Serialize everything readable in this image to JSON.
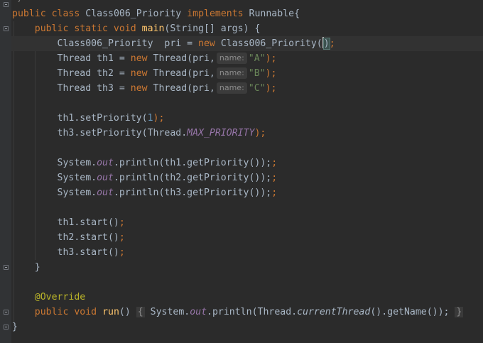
{
  "editor": {
    "top_comment": "*/",
    "class_decl": {
      "kw_public": "public",
      "kw_class": "class",
      "class_name": "Class006_Priority",
      "kw_implements": "implements",
      "iface": "Runnable{"
    },
    "main_decl": {
      "kw": "public static void",
      "name": "main",
      "params": "(String[] args) {"
    },
    "line_pri": {
      "type": "Class006_Priority",
      "var": "pri = ",
      "kw_new": "new",
      "ctor": "Class006_Priority(",
      "close": ")",
      "semi": ";"
    },
    "threads": [
      {
        "decl": "Thread th1 = ",
        "kw_new": "new",
        "call": "Thread(pri,",
        "hint": "name:",
        "arg": "\"A\"",
        "end": ");"
      },
      {
        "decl": "Thread th2 = ",
        "kw_new": "new",
        "call": "Thread(pri,",
        "hint": "name:",
        "arg": "\"B\"",
        "end": ");"
      },
      {
        "decl": "Thread th3 = ",
        "kw_new": "new",
        "call": "Thread(pri,",
        "hint": "name:",
        "arg": "\"C\"",
        "end": ");"
      }
    ],
    "set_priority_1": {
      "pre": "th1.setPriority(",
      "num": "1",
      "end": ");"
    },
    "set_priority_3": {
      "pre": "th3.setPriority(Thread.",
      "field": "MAX_PRIORITY",
      "end": ");"
    },
    "printlns": [
      {
        "pre": "System.",
        "field": "out",
        "post": ".println(th1.getPriority());"
      },
      {
        "pre": "System.",
        "field": "out",
        "post": ".println(th2.getPriority());"
      },
      {
        "pre": "System.",
        "field": "out",
        "post": ".println(th3.getPriority());"
      }
    ],
    "starts": [
      "th1.start()",
      "th2.start()",
      "th3.start()"
    ],
    "semi": ";",
    "close_brace": "}",
    "override": "@Override",
    "run_decl": {
      "kw": "public void",
      "name": "run",
      "parens": "()",
      "fold_open": "{",
      "body_pre": "System.",
      "body_field": "out",
      "body_mid": ".println(Thread.",
      "body_italic": "currentThread",
      "body_post": "().getName());",
      "fold_close": "}"
    },
    "class_close": "}"
  },
  "colors": {
    "background": "#2b2b2b",
    "keyword": "#cc7832",
    "method": "#ffc66d",
    "string": "#6a8759",
    "number": "#6897bb",
    "static_field": "#9876aa",
    "annotation": "#bbb529",
    "text": "#a9b7c6"
  }
}
